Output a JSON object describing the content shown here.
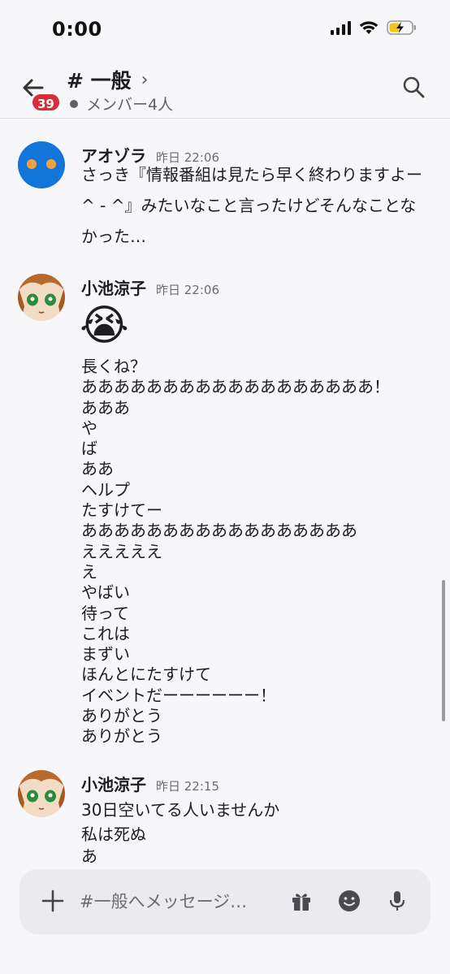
{
  "status_bar": {
    "time": "0:00"
  },
  "header": {
    "back_badge": "39",
    "channel_name": "# 一般",
    "chevron": "›",
    "member_count": "メンバー4人"
  },
  "messages": [
    {
      "avatar": "blue-face-avatar",
      "username": "アオゾラ",
      "timestamp": "昨日 22:06",
      "text": "さっき『情報番組は見たら早く終わりますよー^ - ^』みたいなこと言ったけどそんなことなかった…"
    },
    {
      "avatar": "anime-character-avatar",
      "username": "小池涼子",
      "timestamp": "昨日 22:06",
      "emoji": "😭",
      "lines": [
        "長くね？",
        "ああああああああああああああああああ！",
        "あああ",
        "や",
        "ば",
        "ああ",
        "ヘルプ",
        "たすけてー",
        "あああああああああああああああああ",
        "えええええ",
        "え",
        "やばい",
        "待って",
        "これは",
        "まずい",
        "ほんとにたすけて",
        "イベントだーーーーーー！",
        "ありがとう",
        "ありがとう"
      ]
    },
    {
      "avatar": "anime-character-avatar",
      "username": "小池涼子",
      "timestamp": "昨日 22:15",
      "lines": [
        "30日空いてる人いませんか",
        "私は死ぬ",
        "あ"
      ]
    }
  ],
  "composer": {
    "placeholder": "#一般へメッセージ…"
  },
  "icons": {
    "back": "arrow-left-icon",
    "search": "search-icon",
    "plus": "plus-icon",
    "gift": "gift-icon",
    "emoji": "emoji-icon",
    "mic": "microphone-icon"
  },
  "colors": {
    "badge": "#d62f3a",
    "avatar_blue": "#1275d9",
    "avatar_eye": "#f4a13a"
  }
}
